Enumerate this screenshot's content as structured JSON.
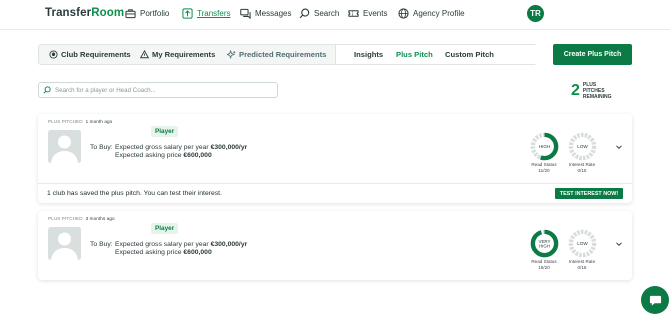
{
  "logo": {
    "part1": "Transfer",
    "part2": "Room"
  },
  "nav": {
    "portfolio": "Portfolio",
    "transfers": "Transfers",
    "messages": "Messages",
    "search": "Search",
    "events": "Events",
    "agency_profile": "Agency Profile",
    "avatar_initials": "TR"
  },
  "tabs": {
    "club_requirements": "Club Requirements",
    "my_requirements": "My Requirements",
    "predicted_requirements": "Predicted Requirements",
    "insights": "Insights",
    "plus_pitch": "Plus Pitch",
    "custom_pitch": "Custom Pitch"
  },
  "create_button": "Create Plus Pitch",
  "search": {
    "placeholder": "Search for a player or Head Coach..."
  },
  "remaining": {
    "count": "2",
    "label": "PLUS PITCHES REMAINING"
  },
  "cards": [
    {
      "pitched_label": "PLUS PITCHED",
      "pitched_ago": "1 month ago",
      "role": "Player",
      "to_buy": "To Buy:",
      "salary_prefix": "Expected gross salary per year ",
      "salary_value": "€300,000/yr",
      "price_prefix": "Expected asking price ",
      "price_value": "€600,000",
      "read_status": {
        "level": "HIGH",
        "label": "Read Status",
        "value": "11/20",
        "fraction": 0.55
      },
      "interest_rate": {
        "level": "LOW",
        "label": "Interest Rate",
        "value": "0/15",
        "fraction": 0
      },
      "footer_text": "1 club has saved the plus pitch. You can test their interest.",
      "footer_button": "TEST INTEREST NOW!"
    },
    {
      "pitched_label": "PLUS PITCHED",
      "pitched_ago": "3 months ago",
      "role": "Player",
      "to_buy": "To Buy:",
      "salary_prefix": "Expected gross salary per year ",
      "salary_value": "€300,000/yr",
      "price_prefix": "Expected asking price ",
      "price_value": "€600,000",
      "read_status": {
        "level_line1": "VERY",
        "level_line2": "HIGH",
        "label": "Read Status",
        "value": "19/20",
        "fraction": 0.95
      },
      "interest_rate": {
        "level": "LOW",
        "label": "Interest Rate",
        "value": "0/18",
        "fraction": 0
      }
    }
  ],
  "colors": {
    "brand_green": "#0b8f4d",
    "button_green": "#0b7a45",
    "gauge_track": "#d7dcdc"
  }
}
